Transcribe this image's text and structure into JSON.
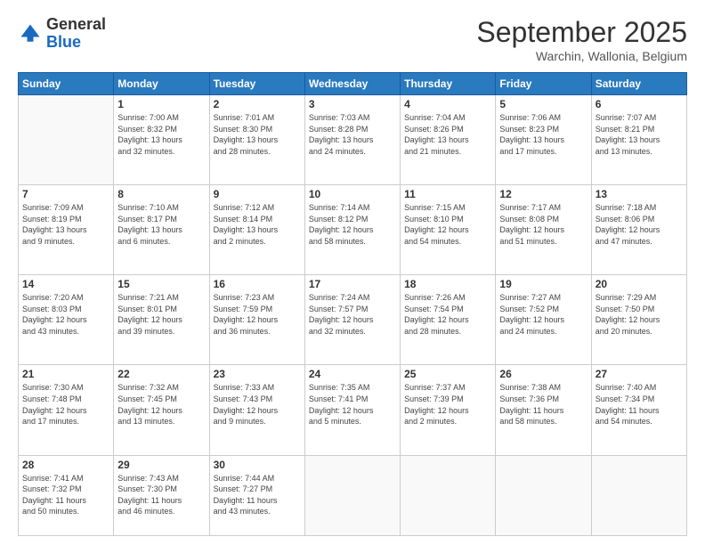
{
  "logo": {
    "general": "General",
    "blue": "Blue"
  },
  "title": {
    "month": "September 2025",
    "location": "Warchin, Wallonia, Belgium"
  },
  "header_days": [
    "Sunday",
    "Monday",
    "Tuesday",
    "Wednesday",
    "Thursday",
    "Friday",
    "Saturday"
  ],
  "weeks": [
    [
      {
        "day": "",
        "content": ""
      },
      {
        "day": "1",
        "content": "Sunrise: 7:00 AM\nSunset: 8:32 PM\nDaylight: 13 hours\nand 32 minutes."
      },
      {
        "day": "2",
        "content": "Sunrise: 7:01 AM\nSunset: 8:30 PM\nDaylight: 13 hours\nand 28 minutes."
      },
      {
        "day": "3",
        "content": "Sunrise: 7:03 AM\nSunset: 8:28 PM\nDaylight: 13 hours\nand 24 minutes."
      },
      {
        "day": "4",
        "content": "Sunrise: 7:04 AM\nSunset: 8:26 PM\nDaylight: 13 hours\nand 21 minutes."
      },
      {
        "day": "5",
        "content": "Sunrise: 7:06 AM\nSunset: 8:23 PM\nDaylight: 13 hours\nand 17 minutes."
      },
      {
        "day": "6",
        "content": "Sunrise: 7:07 AM\nSunset: 8:21 PM\nDaylight: 13 hours\nand 13 minutes."
      }
    ],
    [
      {
        "day": "7",
        "content": "Sunrise: 7:09 AM\nSunset: 8:19 PM\nDaylight: 13 hours\nand 9 minutes."
      },
      {
        "day": "8",
        "content": "Sunrise: 7:10 AM\nSunset: 8:17 PM\nDaylight: 13 hours\nand 6 minutes."
      },
      {
        "day": "9",
        "content": "Sunrise: 7:12 AM\nSunset: 8:14 PM\nDaylight: 13 hours\nand 2 minutes."
      },
      {
        "day": "10",
        "content": "Sunrise: 7:14 AM\nSunset: 8:12 PM\nDaylight: 12 hours\nand 58 minutes."
      },
      {
        "day": "11",
        "content": "Sunrise: 7:15 AM\nSunset: 8:10 PM\nDaylight: 12 hours\nand 54 minutes."
      },
      {
        "day": "12",
        "content": "Sunrise: 7:17 AM\nSunset: 8:08 PM\nDaylight: 12 hours\nand 51 minutes."
      },
      {
        "day": "13",
        "content": "Sunrise: 7:18 AM\nSunset: 8:06 PM\nDaylight: 12 hours\nand 47 minutes."
      }
    ],
    [
      {
        "day": "14",
        "content": "Sunrise: 7:20 AM\nSunset: 8:03 PM\nDaylight: 12 hours\nand 43 minutes."
      },
      {
        "day": "15",
        "content": "Sunrise: 7:21 AM\nSunset: 8:01 PM\nDaylight: 12 hours\nand 39 minutes."
      },
      {
        "day": "16",
        "content": "Sunrise: 7:23 AM\nSunset: 7:59 PM\nDaylight: 12 hours\nand 36 minutes."
      },
      {
        "day": "17",
        "content": "Sunrise: 7:24 AM\nSunset: 7:57 PM\nDaylight: 12 hours\nand 32 minutes."
      },
      {
        "day": "18",
        "content": "Sunrise: 7:26 AM\nSunset: 7:54 PM\nDaylight: 12 hours\nand 28 minutes."
      },
      {
        "day": "19",
        "content": "Sunrise: 7:27 AM\nSunset: 7:52 PM\nDaylight: 12 hours\nand 24 minutes."
      },
      {
        "day": "20",
        "content": "Sunrise: 7:29 AM\nSunset: 7:50 PM\nDaylight: 12 hours\nand 20 minutes."
      }
    ],
    [
      {
        "day": "21",
        "content": "Sunrise: 7:30 AM\nSunset: 7:48 PM\nDaylight: 12 hours\nand 17 minutes."
      },
      {
        "day": "22",
        "content": "Sunrise: 7:32 AM\nSunset: 7:45 PM\nDaylight: 12 hours\nand 13 minutes."
      },
      {
        "day": "23",
        "content": "Sunrise: 7:33 AM\nSunset: 7:43 PM\nDaylight: 12 hours\nand 9 minutes."
      },
      {
        "day": "24",
        "content": "Sunrise: 7:35 AM\nSunset: 7:41 PM\nDaylight: 12 hours\nand 5 minutes."
      },
      {
        "day": "25",
        "content": "Sunrise: 7:37 AM\nSunset: 7:39 PM\nDaylight: 12 hours\nand 2 minutes."
      },
      {
        "day": "26",
        "content": "Sunrise: 7:38 AM\nSunset: 7:36 PM\nDaylight: 11 hours\nand 58 minutes."
      },
      {
        "day": "27",
        "content": "Sunrise: 7:40 AM\nSunset: 7:34 PM\nDaylight: 11 hours\nand 54 minutes."
      }
    ],
    [
      {
        "day": "28",
        "content": "Sunrise: 7:41 AM\nSunset: 7:32 PM\nDaylight: 11 hours\nand 50 minutes."
      },
      {
        "day": "29",
        "content": "Sunrise: 7:43 AM\nSunset: 7:30 PM\nDaylight: 11 hours\nand 46 minutes."
      },
      {
        "day": "30",
        "content": "Sunrise: 7:44 AM\nSunset: 7:27 PM\nDaylight: 11 hours\nand 43 minutes."
      },
      {
        "day": "",
        "content": ""
      },
      {
        "day": "",
        "content": ""
      },
      {
        "day": "",
        "content": ""
      },
      {
        "day": "",
        "content": ""
      }
    ]
  ]
}
